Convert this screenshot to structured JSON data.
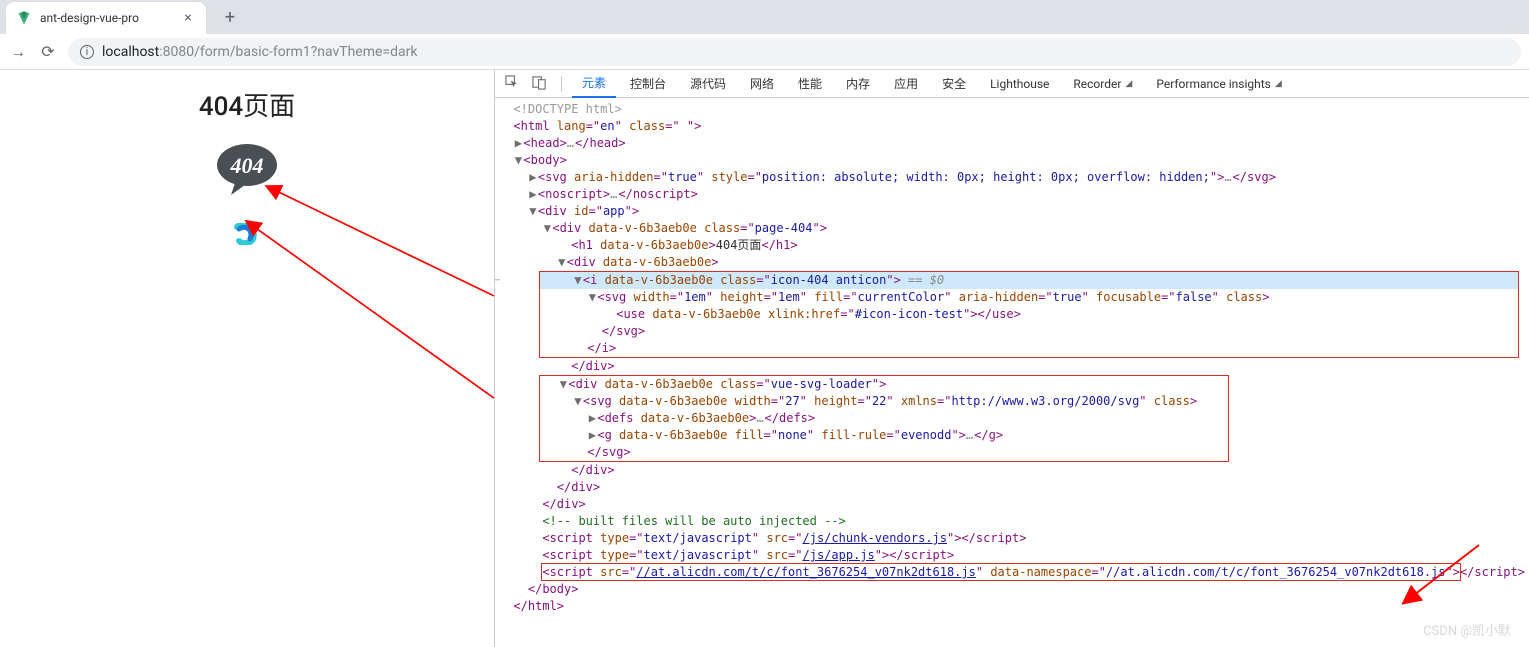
{
  "browser": {
    "tab_title": "ant-design-vue-pro",
    "url_host": "localhost",
    "url_port": ":8080",
    "url_path": "/form/basic-form1?navTheme=dark"
  },
  "page": {
    "heading": "404页面"
  },
  "devtools": {
    "tabs": {
      "elements": "元素",
      "console": "控制台",
      "sources": "源代码",
      "network": "网络",
      "performance": "性能",
      "memory": "内存",
      "application": "应用",
      "security": "安全",
      "lighthouse": "Lighthouse",
      "recorder": "Recorder",
      "perf_insights": "Performance insights"
    },
    "dom": {
      "doctype": "<!DOCTYPE html>",
      "html_open": "html",
      "html_lang": "en",
      "html_class": " ",
      "head": "head",
      "body": "body",
      "svg_aria": {
        "aria_hidden": "true",
        "style": "position: absolute; width: 0px; height: 0px; overflow: hidden;"
      },
      "noscript": "noscript",
      "app_div": {
        "id": "app"
      },
      "page404_div": {
        "data_v": "data-v-6b3aeb0e",
        "class": "page-404"
      },
      "h1_text": "404页面",
      "inner_div": {
        "data_v": "data-v-6b3aeb0e"
      },
      "i_tag": {
        "data_v": "data-v-6b3aeb0e",
        "class": "icon-404 anticon",
        "cursor": " == $0"
      },
      "i_svg": {
        "width": "1em",
        "height": "1em",
        "fill": "currentColor",
        "aria_hidden": "true",
        "focusable": "false"
      },
      "use": {
        "data_v": "data-v-6b3aeb0e",
        "xlink_href": "#icon-icon-test"
      },
      "vue_loader_div": {
        "data_v": "data-v-6b3aeb0e",
        "class": "vue-svg-loader"
      },
      "loader_svg": {
        "data_v": "data-v-6b3aeb0e",
        "width": "27",
        "height": "22",
        "xmlns": "http://www.w3.org/2000/svg"
      },
      "defs": {
        "data_v": "data-v-6b3aeb0e"
      },
      "g": {
        "data_v": "data-v-6b3aeb0e",
        "fill": "none",
        "fill_rule": "evenodd"
      },
      "comment": "<!-- built files will be auto injected -->",
      "script1": {
        "type": "text/javascript",
        "src": "/js/chunk-vendors.js"
      },
      "script2": {
        "type": "text/javascript",
        "src": "/js/app.js"
      },
      "script3": {
        "src": "//at.alicdn.com/t/c/font_3676254_v07nk2dt618.js",
        "data_ns": "//at.alicdn.com/t/c/font_3676254_v07nk2dt618.js"
      }
    }
  },
  "watermark": "CSDN @凯小默"
}
